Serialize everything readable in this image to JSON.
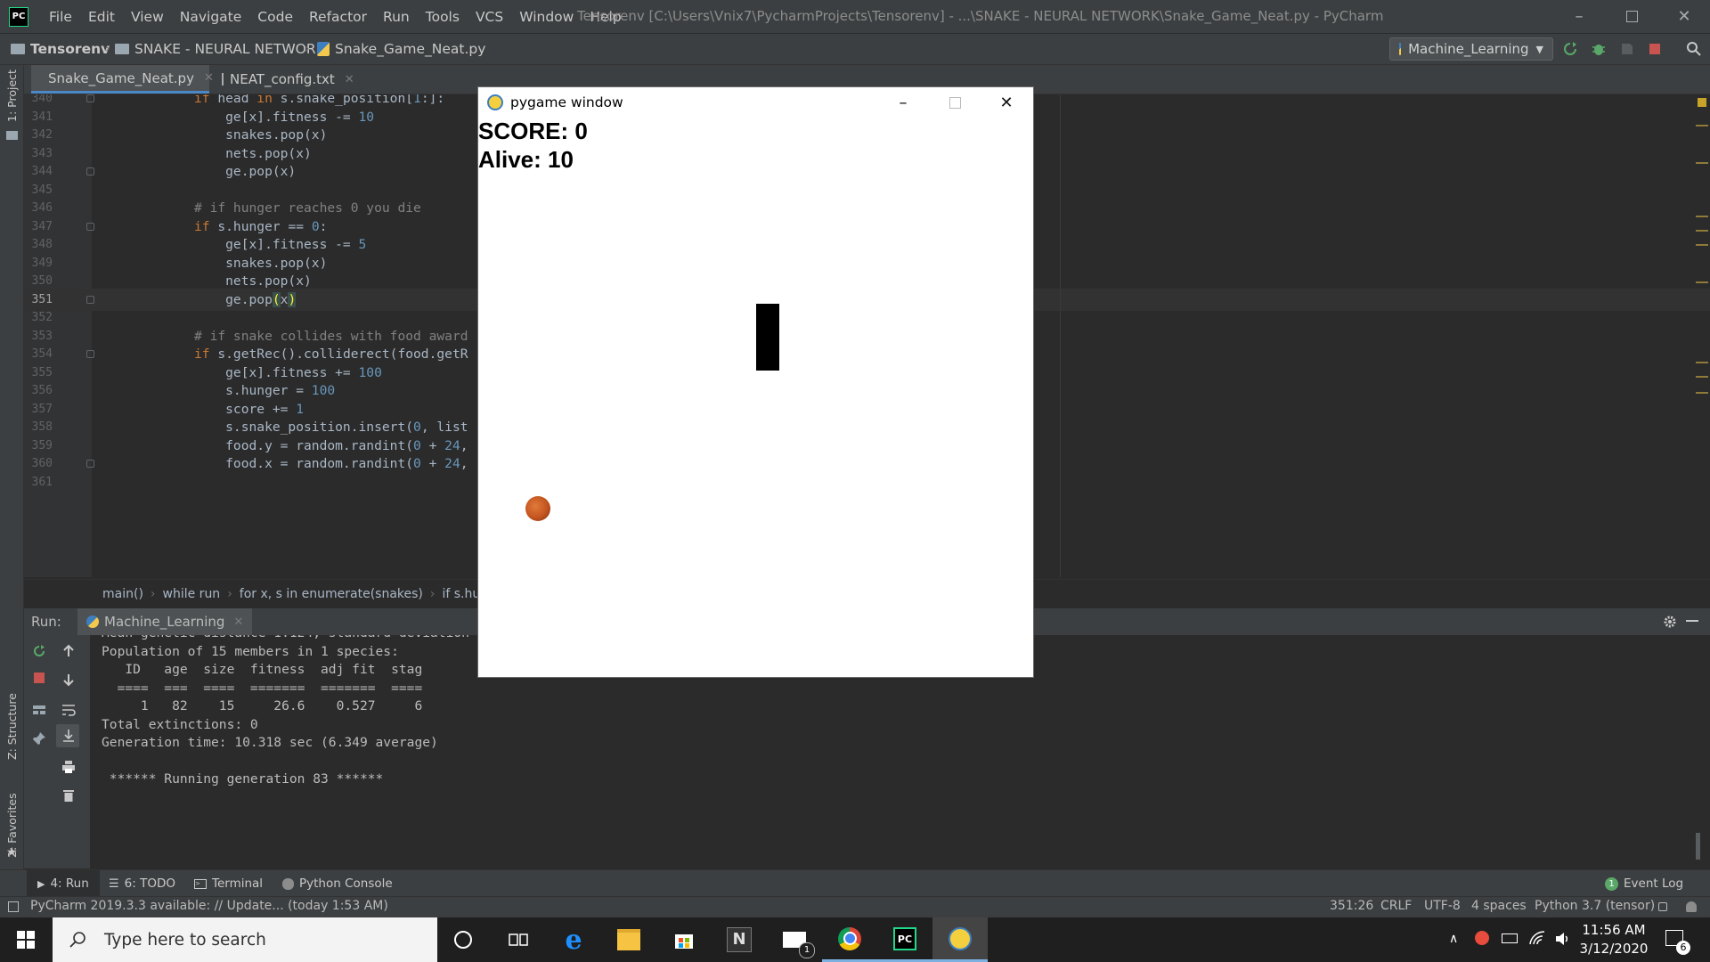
{
  "menu": [
    "File",
    "Edit",
    "View",
    "Navigate",
    "Code",
    "Refactor",
    "Run",
    "Tools",
    "VCS",
    "Window",
    "Help"
  ],
  "window_title": "Tensorenv [C:\\Users\\Vnix7\\PycharmProjects\\Tensorenv] - ...\\SNAKE - NEURAL NETWORK\\Snake_Game_Neat.py - PyCharm",
  "app_logo": "PC",
  "breadcrumbs": [
    "Tensorenv",
    "SNAKE - NEURAL NETWORK",
    "Snake_Game_Neat.py"
  ],
  "run_config": "Machine_Learning",
  "left_strip": {
    "project": "1: Project",
    "structure": "Z: Structure",
    "favorites": "2: Favorites"
  },
  "editor_tabs": [
    {
      "label": "Snake_Game_Neat.py",
      "active": true
    },
    {
      "label": "NEAT_config.txt",
      "active": false
    }
  ],
  "code_lines": [
    {
      "n": "340",
      "code": "if head in s.snake_position[1:]:"
    },
    {
      "n": "341",
      "code": "    ge[x].fitness -= 10"
    },
    {
      "n": "342",
      "code": "    snakes.pop(x)"
    },
    {
      "n": "343",
      "code": "    nets.pop(x)"
    },
    {
      "n": "344",
      "code": "    ge.pop(x)"
    },
    {
      "n": "345",
      "code": ""
    },
    {
      "n": "346",
      "code": "# if hunger reaches 0 you die"
    },
    {
      "n": "347",
      "code": "if s.hunger == 0:"
    },
    {
      "n": "348",
      "code": "    ge[x].fitness -= 5"
    },
    {
      "n": "349",
      "code": "    snakes.pop(x)"
    },
    {
      "n": "350",
      "code": "    nets.pop(x)"
    },
    {
      "n": "351",
      "code": "    ge.pop(x)"
    },
    {
      "n": "352",
      "code": ""
    },
    {
      "n": "353",
      "code": "# if snake collides with food award"
    },
    {
      "n": "354",
      "code": "if s.getRec().colliderect(food.getR"
    },
    {
      "n": "355",
      "code": "    ge[x].fitness += 100"
    },
    {
      "n": "356",
      "code": "    s.hunger = 100"
    },
    {
      "n": "357",
      "code": "    score += 1"
    },
    {
      "n": "358",
      "code": "    s.snake_position.insert(0, list"
    },
    {
      "n": "359",
      "code": "    food.y = random.randint(0 + 24,"
    },
    {
      "n": "360",
      "code": "    food.x = random.randint(0 + 24,"
    },
    {
      "n": "361",
      "code": ""
    }
  ],
  "code_breadcrumb": [
    "main()",
    "while run",
    "for x, s in enumerate(snakes)",
    "if s.hu"
  ],
  "run": {
    "label": "Run:",
    "tab": "Machine_Learning"
  },
  "console_lines": [
    "Mean genetic distance 1.124, standard deviation",
    "Population of 15 members in 1 species:",
    "   ID   age  size  fitness  adj fit  stag",
    "  ====  ===  ====  =======  =======  ====",
    "     1   82    15     26.6    0.527     6",
    "Total extinctions: 0",
    "Generation time: 10.318 sec (6.349 average)",
    "",
    " ****** Running generation 83 ******"
  ],
  "bottom_tabs": [
    "4: Run",
    "6: TODO",
    "Terminal",
    "Python Console"
  ],
  "event_log": {
    "count": "1",
    "label": "Event Log"
  },
  "status": {
    "message": "PyCharm 2019.3.3 available: // Update... (today 1:53 AM)",
    "position": "351:26",
    "line_sep": "CRLF",
    "encoding": "UTF-8",
    "indent": "4 spaces",
    "interpreter": "Python 3.7 (tensor)"
  },
  "taskbar": {
    "search_placeholder": "Type here to search",
    "mail_badge": "1",
    "time": "11:56 AM",
    "date": "3/12/2020",
    "notif_count": "6"
  },
  "pygame": {
    "title": "pygame window",
    "score": "SCORE: 0",
    "alive": "Alive: 10"
  },
  "colors": {
    "keyword": "#cc7832",
    "number": "#6897bb",
    "comment": "#808080",
    "accent": "#4a88c7"
  }
}
